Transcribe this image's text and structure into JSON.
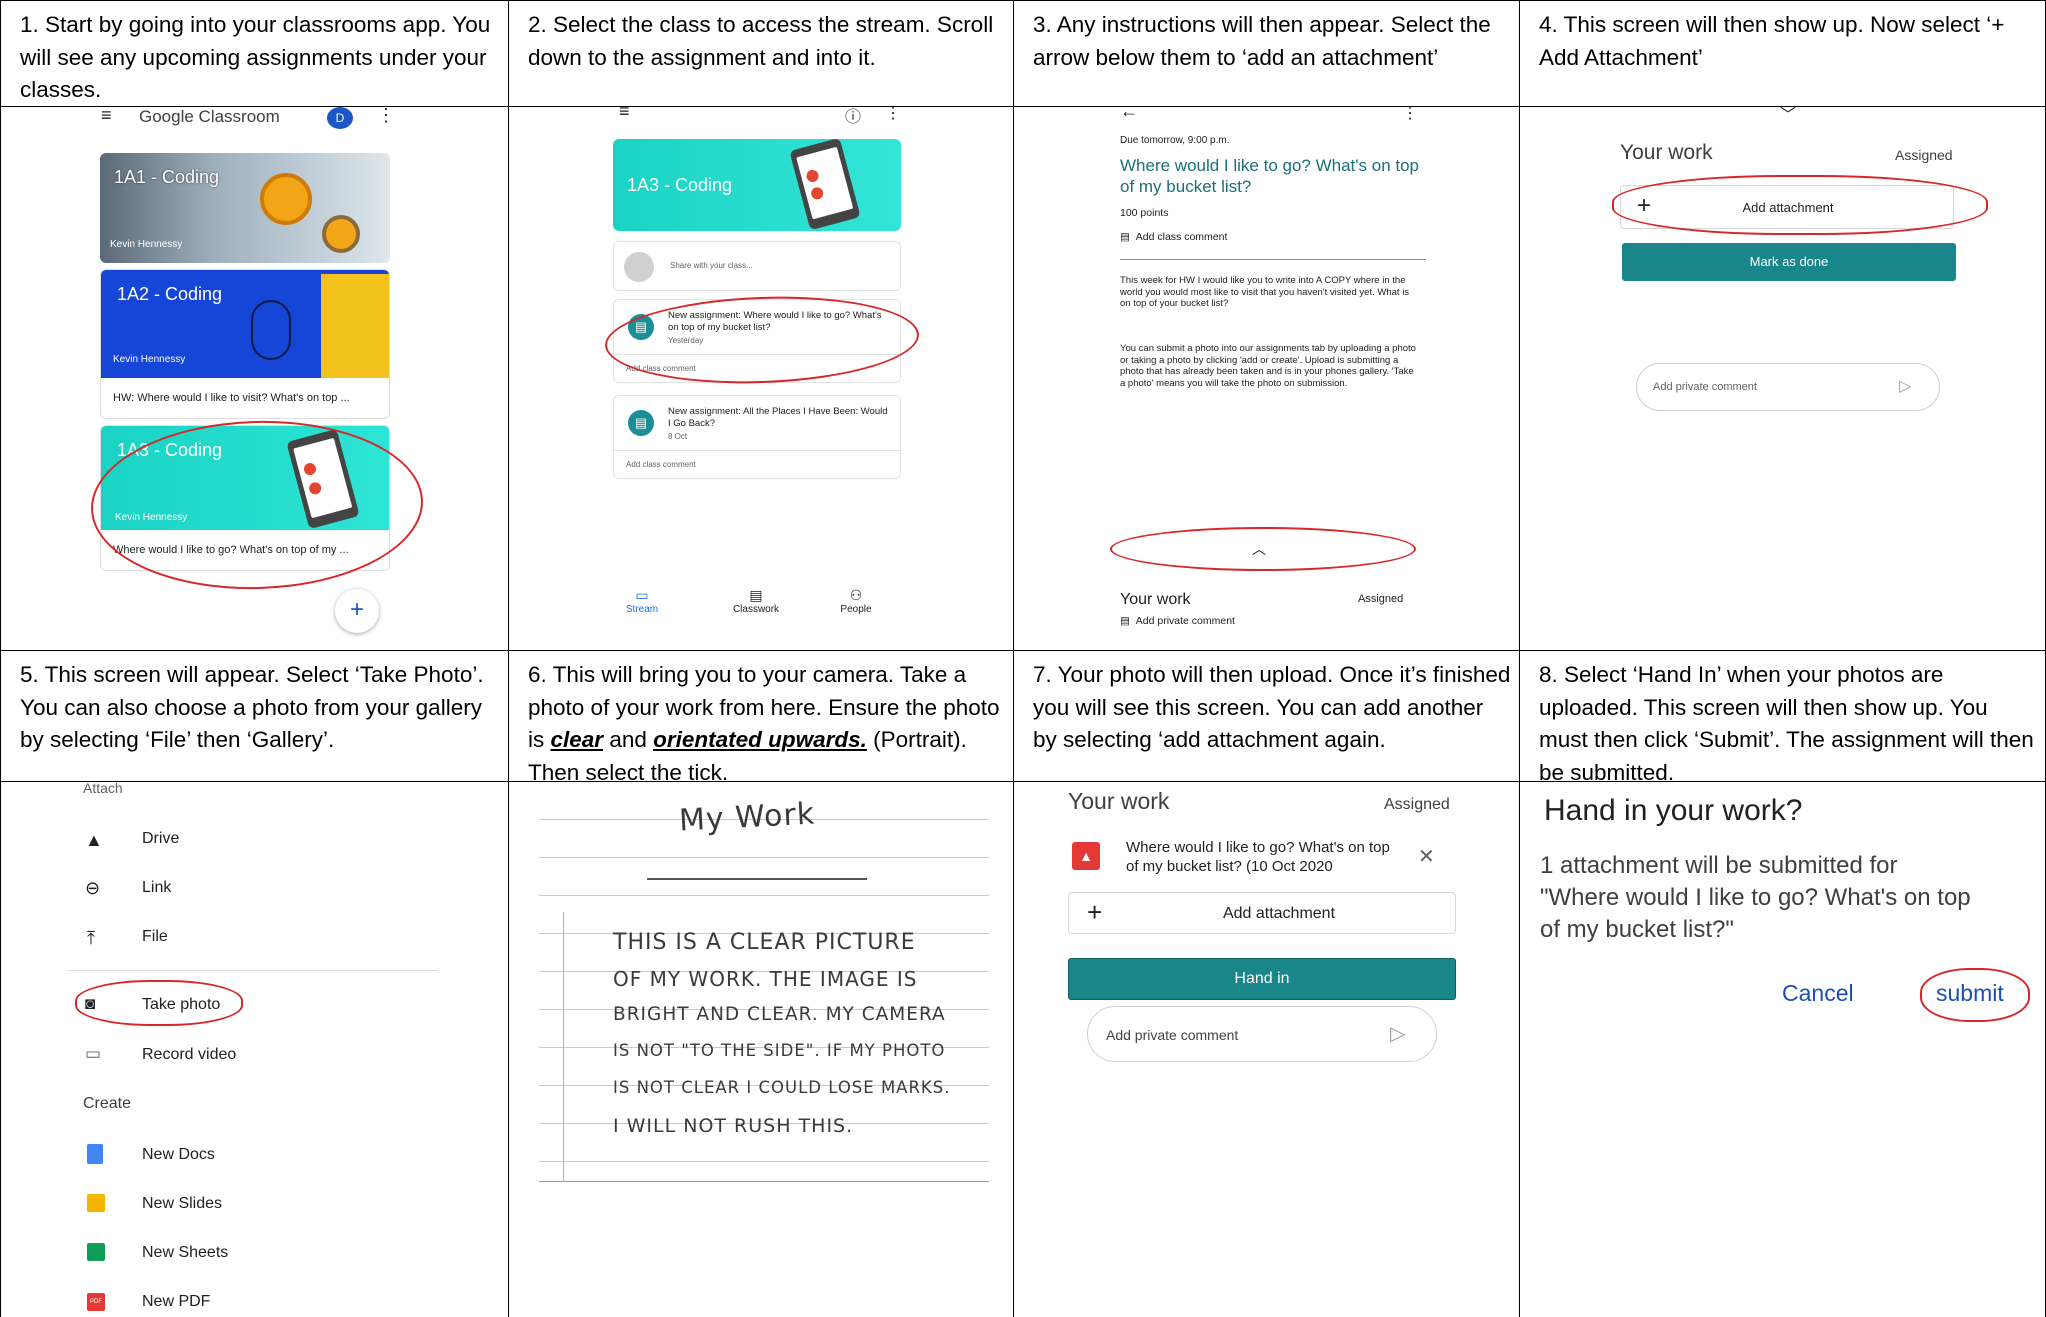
{
  "steps": [
    {
      "n": "1",
      "text": "1. Start by going into your classrooms app. You will see any upcoming assignments under your classes."
    },
    {
      "n": "2",
      "text": "2. Select the class to access the stream. Scroll down to the assignment and into it."
    },
    {
      "n": "3",
      "text": "3. Any instructions will then appear. Select the arrow below them to ‘add an attachment’"
    },
    {
      "n": "4",
      "text": "4. This screen will then show up. Now select ‘+ Add Attachment’"
    },
    {
      "n": "5",
      "text": "5. This screen will appear. Select ‘Take Photo’. You can also choose a photo from your gallery by selecting ‘File’ then ‘Gallery’."
    },
    {
      "n": "6",
      "pre": "6. This will bring you to your camera. Take a photo of your work from here. Ensure the photo is ",
      "clear": "clear",
      "mid": " and ",
      "orient": "orientated upwards.",
      "post": " (Portrait). Then select the tick."
    },
    {
      "n": "7",
      "text": "7. Your photo will then upload. Once it’s finished you will see this screen. You can add another by selecting ‘add attachment again."
    },
    {
      "n": "8",
      "text": "8. Select ‘Hand In’ when your photos are uploaded. This screen will then show up. You must then click ‘Submit’. The assignment will then be submitted."
    }
  ],
  "s1": {
    "app_title": "Google Classroom",
    "avatar": "D",
    "classes": [
      {
        "name": "1A1 - Coding",
        "teacher": "Kevin Hennessy",
        "note": ""
      },
      {
        "name": "1A2 - Coding",
        "teacher": "Kevin Hennessy",
        "note": "HW: Where would I like to visit? What's on top ..."
      },
      {
        "name": "1A3 - Coding",
        "teacher": "Kevin Hennessy",
        "note": "Where would I like to go? What's on top of my ..."
      }
    ],
    "fab": "+"
  },
  "s2": {
    "class_name": "1A3 - Coding",
    "share": "Share with your class...",
    "posts": [
      {
        "title": "New assignment: Where would I like to go? What's on top of my bucket list?",
        "date": "Yesterday",
        "comment": "Add class comment"
      },
      {
        "title": "New assignment: All the Places I Have Been: Would I Go Back?",
        "date": "8 Oct",
        "comment": "Add class comment"
      }
    ],
    "nav": [
      "Stream",
      "Classwork",
      "People"
    ]
  },
  "s3": {
    "due": "Due tomorrow, 9:00 p.m.",
    "title": "Where would I like to go? What's on top of my bucket list?",
    "points": "100 points",
    "class_comment": "Add class comment",
    "para1": "This week for HW I would like you to write into A COPY where in the world you would most like to visit that you haven't visited yet. What is on top of your bucket list?",
    "para2": "You can submit a photo into our assignments tab by uploading a photo or taking a photo by clicking 'add or create'. Upload is submitting a photo that has already been taken and is in your phones gallery. 'Take a photo' means you will take the photo on submission.",
    "your_work": "Your work",
    "status": "Assigned",
    "private": "Add private comment"
  },
  "s4": {
    "your_work": "Your work",
    "status": "Assigned",
    "add": "Add attachment",
    "done": "Mark as done",
    "private": "Add private comment"
  },
  "s5": {
    "attach": "Attach",
    "items": [
      "Drive",
      "Link",
      "File",
      "Take photo",
      "Record video"
    ],
    "create": "Create",
    "create_items": [
      "New Docs",
      "New Slides",
      "New Sheets",
      "New PDF"
    ]
  },
  "s6": {
    "heading": "My Work",
    "lines": [
      "THIS IS A CLEAR PICTURE",
      "OF MY WORK. THE IMAGE IS",
      "BRIGHT AND CLEAR. MY CAMERA",
      "IS NOT \"TO THE SIDE\". IF MY PHOTO",
      "IS NOT CLEAR I COULD LOSE MARKS.",
      "I WILL NOT RUSH THIS."
    ]
  },
  "s7": {
    "your_work": "Your work",
    "status": "Assigned",
    "file": "Where would I like to go? What's on top of my bucket list? (10 Oct 2020",
    "add": "Add attachment",
    "hand_in": "Hand in",
    "private": "Add private comment"
  },
  "s8": {
    "title": "Hand in your work?",
    "body": "1 attachment will be submitted for \"Where would I like to go? What's on top of my bucket list?\"",
    "cancel": "Cancel",
    "submit": "submit"
  },
  "colors": {
    "teal": "#18868a",
    "blue": "#1a73e8",
    "red_circle": "#d62828",
    "coding_cyan": "#1ad3c4",
    "coding_blue": "#1546d8"
  }
}
